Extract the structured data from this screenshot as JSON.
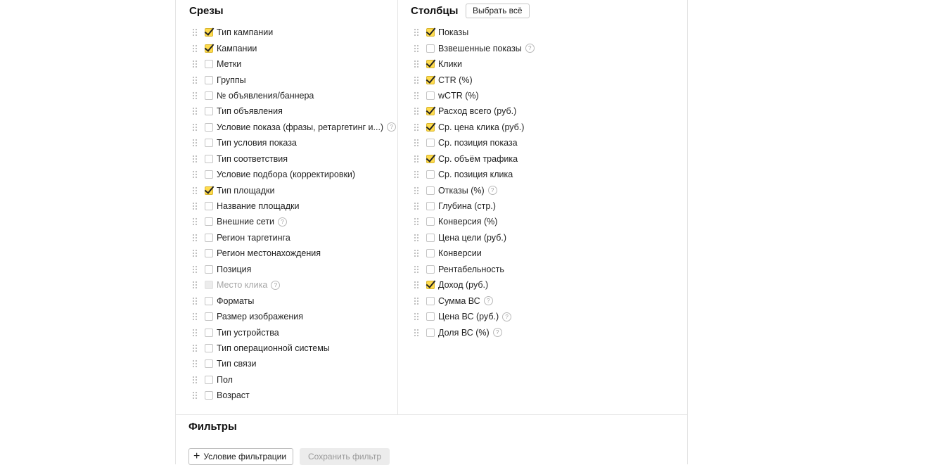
{
  "slices": {
    "title": "Срезы",
    "items": [
      {
        "label": "Тип кампании",
        "checked": true
      },
      {
        "label": "Кампании",
        "checked": true
      },
      {
        "label": "Метки",
        "checked": false
      },
      {
        "label": "Группы",
        "checked": false
      },
      {
        "label": "№ объявления/баннера",
        "checked": false
      },
      {
        "label": "Тип объявления",
        "checked": false
      },
      {
        "label": "Условие показа (фразы, ретаргетинг и...)",
        "checked": false,
        "help": true
      },
      {
        "label": "Тип условия показа",
        "checked": false
      },
      {
        "label": "Тип соответствия",
        "checked": false
      },
      {
        "label": "Условие подбора (корректировки)",
        "checked": false
      },
      {
        "label": "Тип площадки",
        "checked": true
      },
      {
        "label": "Название площадки",
        "checked": false
      },
      {
        "label": "Внешние сети",
        "checked": false,
        "help": true
      },
      {
        "label": "Регион таргетинга",
        "checked": false
      },
      {
        "label": "Регион местонахождения",
        "checked": false
      },
      {
        "label": "Позиция",
        "checked": false
      },
      {
        "label": "Место клика",
        "checked": false,
        "disabled": true,
        "help": true
      },
      {
        "label": "Форматы",
        "checked": false
      },
      {
        "label": "Размер изображения",
        "checked": false
      },
      {
        "label": "Тип устройства",
        "checked": false
      },
      {
        "label": "Тип операционной системы",
        "checked": false
      },
      {
        "label": "Тип связи",
        "checked": false
      },
      {
        "label": "Пол",
        "checked": false
      },
      {
        "label": "Возраст",
        "checked": false
      }
    ]
  },
  "columns": {
    "title": "Столбцы",
    "select_all_label": "Выбрать всё",
    "items": [
      {
        "label": "Показы",
        "checked": true
      },
      {
        "label": "Взвешенные показы",
        "checked": false,
        "help": true
      },
      {
        "label": "Клики",
        "checked": true
      },
      {
        "label": "CTR (%)",
        "checked": true
      },
      {
        "label": "wCTR (%)",
        "checked": false
      },
      {
        "label": "Расход всего (руб.)",
        "checked": true
      },
      {
        "label": "Ср. цена клика (руб.)",
        "checked": true
      },
      {
        "label": "Ср. позиция показа",
        "checked": false
      },
      {
        "label": "Ср. объём трафика",
        "checked": true
      },
      {
        "label": "Ср. позиция клика",
        "checked": false
      },
      {
        "label": "Отказы (%)",
        "checked": false,
        "help": true
      },
      {
        "label": "Глубина (стр.)",
        "checked": false
      },
      {
        "label": "Конверсия (%)",
        "checked": false
      },
      {
        "label": "Цена цели (руб.)",
        "checked": false
      },
      {
        "label": "Конверсии",
        "checked": false
      },
      {
        "label": "Рентабельность",
        "checked": false
      },
      {
        "label": "Доход (руб.)",
        "checked": true
      },
      {
        "label": "Сумма ВС",
        "checked": false,
        "help": true
      },
      {
        "label": "Цена ВС (руб.)",
        "checked": false,
        "help": true
      },
      {
        "label": "Доля ВС (%)",
        "checked": false,
        "help": true
      }
    ]
  },
  "filters": {
    "title": "Фильтры",
    "add_condition_label": "Условие фильтрации",
    "save_filter_label": "Сохранить фильтр"
  },
  "colors": {
    "checkbox_checked": "#ffdb4d",
    "border": "#e4e4e4"
  }
}
